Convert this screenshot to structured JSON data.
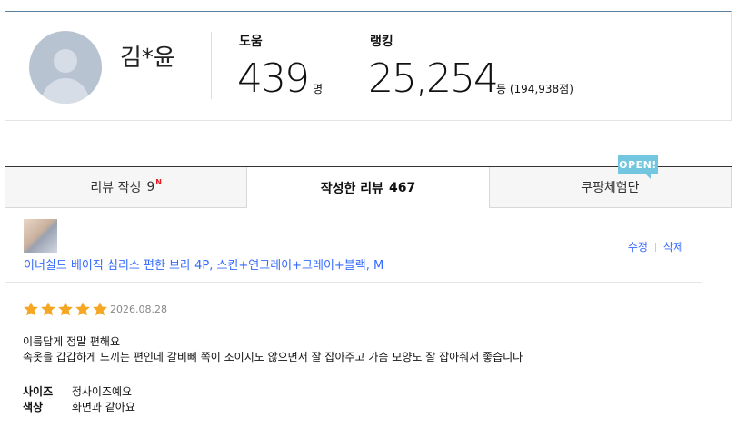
{
  "profile": {
    "name": "김*윤",
    "help": {
      "label": "도움",
      "value": "439",
      "unit": "명"
    },
    "rank": {
      "label": "랭킹",
      "value": "25,254",
      "unit": "등 (194,938점)"
    }
  },
  "tabs": [
    {
      "label": "리뷰 작성",
      "count": "9",
      "badge": "N"
    },
    {
      "label": "작성한 리뷰",
      "count": "467"
    },
    {
      "label": "쿠팡체험단"
    }
  ],
  "open_badge": "OPEN!",
  "review": {
    "product": "이너쉴드 베이직 심리스 편한 브라 4P, 스킨+연그레이+그레이+블랙, M",
    "edit_label": "수정",
    "delete_label": "삭제",
    "rating": 5,
    "date": "2026.08.28",
    "content_line1": "이름답게 정말 편해요",
    "content_line2": "속옷을 갑갑하게 느끼는 편인데 갈비뼈 쪽이 조이지도 않으면서 잘 잡아주고 가슴 모양도 잘 잡아줘서 좋습니다",
    "attrs": [
      {
        "key": "사이즈",
        "value": "정사이즈예요"
      },
      {
        "key": "색상",
        "value": "화면과 같아요"
      }
    ]
  },
  "colors": {
    "accent": "#346aff",
    "star": "#f5a623",
    "open": "#72c6df",
    "new": "#e31b23"
  }
}
